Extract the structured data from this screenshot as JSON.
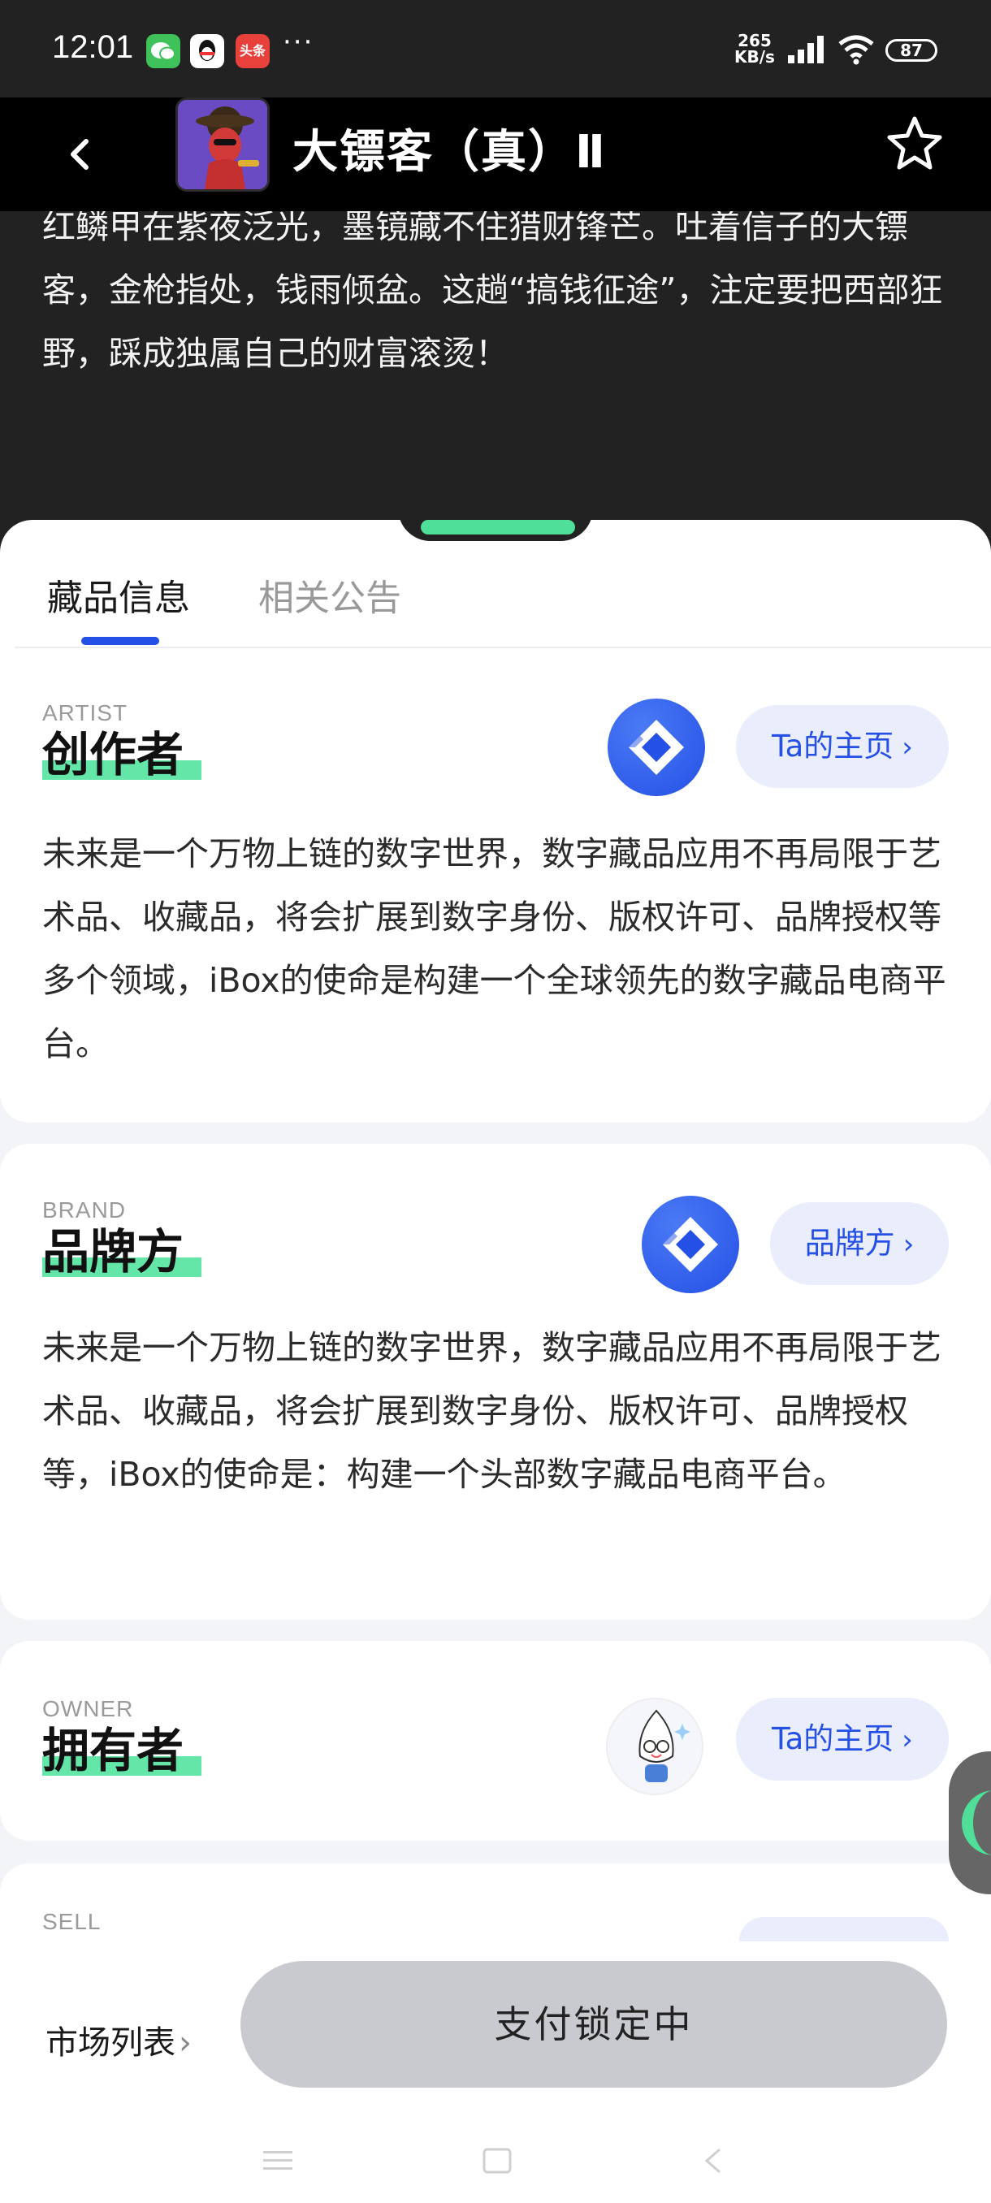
{
  "status_bar": {
    "time": "12:01",
    "more": "···",
    "net_speed": "265",
    "net_unit": "KB/s",
    "battery": "87",
    "app_icons": [
      "wechat-icon",
      "qq-icon",
      "toutiao-icon"
    ],
    "toutiao_label": "头条"
  },
  "header": {
    "title": "大镖客（真）Ⅱ"
  },
  "description": {
    "text": "红鳞甲在紫夜泛光，墨镜藏不住猎财锋芒。吐着信子的大镖客，金枪指处，钱雨倾盆。这趟“搞钱征途”，注定要把西部狂野，踩成独属自己的财富滚烫！"
  },
  "tabs": [
    {
      "label": "藏品信息",
      "active": true
    },
    {
      "label": "相关公告",
      "active": false
    }
  ],
  "artist": {
    "kicker": "ARTIST",
    "heading": "创作者",
    "button": "Ta的主页",
    "body": "未来是一个万物上链的数字世界，数字藏品应用不再局限于艺术品、收藏品，将会扩展到数字身份、版权许可、品牌授权等多个领域，iBox的使命是构建一个全球领先的数字藏品电商平台。"
  },
  "brand": {
    "kicker": "BRAND",
    "heading": "品牌方",
    "button": "品牌方",
    "body": "未来是一个万物上链的数字世界，数字藏品应用不再局限于艺术品、收藏品，将会扩展到数字身份、版权许可、品牌授权等，iBox的使命是：构建一个头部数字藏品电商平台。"
  },
  "owner": {
    "kicker": "OWNER",
    "heading": "拥有者",
    "button": "Ta的主页"
  },
  "sell": {
    "kicker": "SELL"
  },
  "bottom": {
    "market_link": "市场列表",
    "pay_button": "支付锁定中"
  },
  "colors": {
    "accent_blue": "#2550e6",
    "highlight_green": "#63e6a8",
    "handle_green": "#4fdf98",
    "pill_bg": "#eaedfc",
    "disabled_btn": "#c9cacf"
  }
}
